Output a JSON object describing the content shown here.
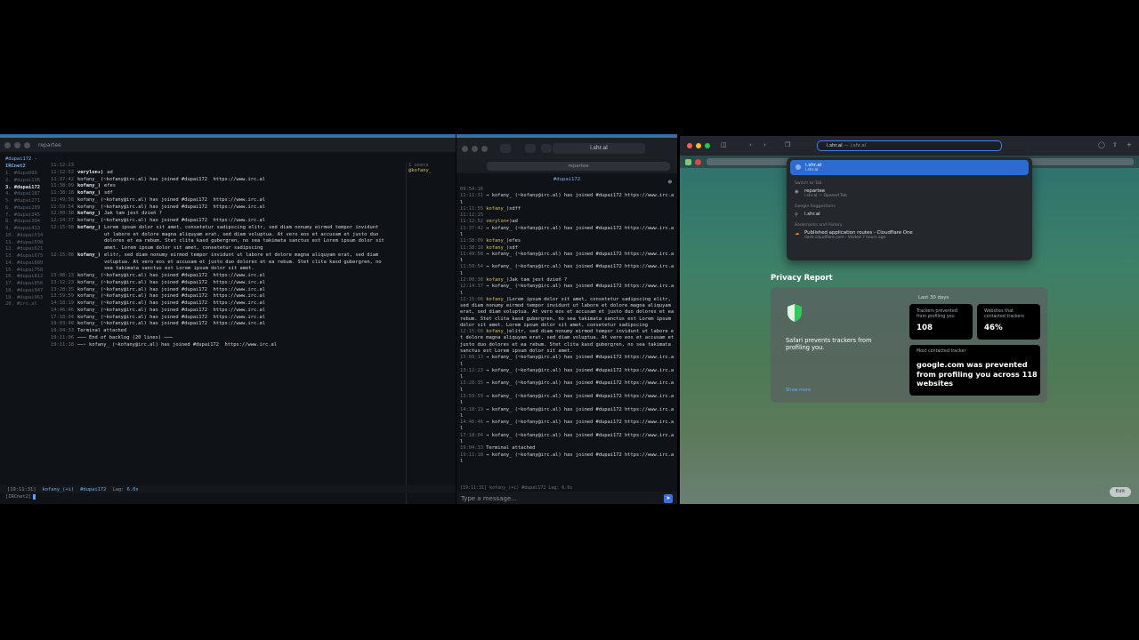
{
  "left_terminal": {
    "window_title": "repartee",
    "channel_header": "#dupai172 -",
    "network_label": "IRCnet2",
    "channels": [
      {
        "label": "1. #dupa999",
        "active": false
      },
      {
        "label": "2. #dupai136",
        "active": false
      },
      {
        "label": "3. #dupai172",
        "active": true
      },
      {
        "label": "4. #dupai187",
        "active": false
      },
      {
        "label": "5. #dupai271",
        "active": false
      },
      {
        "label": "6. #dupai289",
        "active": false
      },
      {
        "label": "7. #dupai345",
        "active": false
      },
      {
        "label": "8. #dupai394",
        "active": false
      },
      {
        "label": "9. #dupai413",
        "active": false
      },
      {
        "label": "10. #dupai534",
        "active": false
      },
      {
        "label": "11. #dupai598",
        "active": false
      },
      {
        "label": "12. #dupai621",
        "active": false
      },
      {
        "label": "13. #dupai675",
        "active": false
      },
      {
        "label": "14. #dupai689",
        "active": false
      },
      {
        "label": "15. #dupai758",
        "active": false
      },
      {
        "label": "16. #dupai812",
        "active": false
      },
      {
        "label": "17. #dupai856",
        "active": false
      },
      {
        "label": "18. #dupai947",
        "active": false
      },
      {
        "label": "19. #dupai963",
        "active": false
      },
      {
        "label": "20. #irc.al",
        "active": false
      }
    ],
    "messages": [
      {
        "ts": "11:12:23",
        "nick": "",
        "text": ""
      },
      {
        "ts": "11:12:52",
        "nick": "verylon+)",
        "text": "ad"
      },
      {
        "ts": "11:37:42",
        "nick": "",
        "text": "kofany_ (~kofany@irc.al) has joined #dupai172  https://www.irc.al"
      },
      {
        "ts": "11:38:09",
        "nick": "kofany_)",
        "text": "efes"
      },
      {
        "ts": "11:38:18",
        "nick": "kofany_)",
        "text": "sdf"
      },
      {
        "ts": "11:49:58",
        "nick": "",
        "text": "kofany_ (~kofany@irc.al) has joined #dupai172  https://www.irc.al"
      },
      {
        "ts": "11:59:54",
        "nick": "",
        "text": "kofany_ (~kofany@irc.al) has joined #dupai172  https://www.irc.al"
      },
      {
        "ts": "12:00:38",
        "nick": "kofany_)",
        "text": "Jak tam jest dzień ?"
      },
      {
        "ts": "12:14:37",
        "nick": "",
        "text": "kofany_ (~kofany@irc.al) has joined #dupai172  https://www.irc.al"
      },
      {
        "ts": "12:15:08",
        "nick": "kofany_)",
        "text": "Lorem ipsum dolor sit amet, consetetur sadipscing elitr, sed diam nonumy eirmod tempor invidunt",
        "cont": [
          "ut labore et dolore magna aliquyam erat, sed diam voluptua. At vero eos et accusam et justo duo",
          "dolores et ea rebum. Stet clita kasd gubergren, no sea takimata sanctus est Lorem ipsum dolor sit",
          "amet. Lorem ipsum dolor sit amet, consetetur sadipscing"
        ]
      },
      {
        "ts": "12:15:08",
        "nick": "kofany_)",
        "text": "elitr, sed diam nonumy eirmod tempor invidunt ut labore et dolore magna aliquyam erat, sed diam",
        "cont": [
          "voluptua. At vero eos et accusam et justo duo dolores et ea rebum. Stet clita kasd gubergren, no",
          "sea takimata sanctus est Lorem ipsum dolor sit amet."
        ]
      },
      {
        "ts": "13:08:13",
        "nick": "",
        "text": "kofany_ (~kofany@irc.al) has joined #dupai172  https://www.irc.al"
      },
      {
        "ts": "13:12:23",
        "nick": "",
        "text": "kofany_ (~kofany@irc.al) has joined #dupai172  https://www.irc.al"
      },
      {
        "ts": "13:28:35",
        "nick": "",
        "text": "kofany_ (~kofany@irc.al) has joined #dupai172  https://www.irc.al"
      },
      {
        "ts": "13:59:59",
        "nick": "",
        "text": "kofany_ (~kofany@irc.al) has joined #dupai172  https://www.irc.al"
      },
      {
        "ts": "14:18:19",
        "nick": "",
        "text": "kofany_ (~kofany@irc.al) has joined #dupai172  https://www.irc.al"
      },
      {
        "ts": "14:46:46",
        "nick": "",
        "text": "kofany_ (~kofany@irc.al) has joined #dupai172  https://www.irc.al"
      },
      {
        "ts": "17:18:04",
        "nick": "",
        "text": "kofany_ (~kofany@irc.al) has joined #dupai172  https://www.irc.al"
      },
      {
        "ts": "19:03:48",
        "nick": "",
        "text": "kofany_ (~kofany@irc.al) has joined #dupai172  https://www.irc.al"
      },
      {
        "ts": "19:04:33",
        "nick": "",
        "text": "Terminal attached"
      },
      {
        "ts": "19:11:06",
        "nick": "",
        "text": "─── End of backlog (20 lines) ───"
      },
      {
        "ts": "19:11:18",
        "nick": "",
        "text": "──› kofany_ (~kofany@irc.al) has joined #dupai172  https://www.irc.al"
      }
    ],
    "users_count": "1 users",
    "users": [
      "@kofany_"
    ],
    "status": {
      "time": "[19:11:31]",
      "nick": "kofany_(+i)",
      "channel": "#dupai172",
      "lag_label": "Lag:",
      "lag_value": "6.0s"
    },
    "input_prompt": "[IRCnet2]"
  },
  "middle_window": {
    "url": "i.shr.al",
    "tab_label": "repartee",
    "channel": "#dupai172",
    "lines": [
      {
        "t": "09:54:16",
        "n": "",
        "x": ""
      },
      {
        "t": "11:11:31",
        "n": "",
        "x": "→ kofany_ (~kofany@irc.al) has joined #dupai172 https://www.irc.al"
      },
      {
        "t": "11:11:55",
        "n": "kofany_",
        "x": ")sdff"
      },
      {
        "t": "11:12:25",
        "n": "",
        "x": ""
      },
      {
        "t": "11:12:52",
        "n": "verylon+",
        "x": ")ad"
      },
      {
        "t": "11:37:42",
        "n": "",
        "x": "→ kofany_ (~kofany@irc.al) has joined #dupai172 https://www.irc.al"
      },
      {
        "t": "11:38:09",
        "n": "kofany_",
        "x": ")efes"
      },
      {
        "t": "11:38:18",
        "n": "kofany_",
        "x": ")sdf"
      },
      {
        "t": "11:49:58",
        "n": "",
        "x": "→ kofany_ (~kofany@irc.al) has joined #dupai172 https://www.irc.al"
      },
      {
        "t": "11:59:54",
        "n": "",
        "x": "→ kofany_ (~kofany@irc.al) has joined #dupai172 https://www.irc.al"
      },
      {
        "t": "12:00:38",
        "n": "kofany_",
        "x": ")Jak tam jest dzień ?"
      },
      {
        "t": "12:14:37",
        "n": "",
        "x": "→ kofany_ (~kofany@irc.al) has joined #dupai172 https://www.irc.al"
      },
      {
        "t": "12:15:08",
        "n": "kofany_",
        "x": ")Lorem ipsum dolor sit amet, consetetur sadipscing elitr, sed diam nonumy eirmod tempor invidunt ut labore et dolore magna aliquyam erat, sed diam voluptua. At vero eos et accusam et justo duo dolores et ea rebum. Stet clita kasd gubergren, no sea takimata sanctus est Lorem ipsum dolor sit amet. Lorem ipsum dolor sit amet, consetetur sadipscing"
      },
      {
        "t": "12:15:08",
        "n": "kofany_",
        "x": ")elitr, sed diam nonumy eirmod tempor invidunt ut labore et dolore magna aliquyam erat, sed diam voluptua. At vero eos et accusam et justo duo dolores et ea rebum. Stet clita kasd gubergren, no sea takimata sanctus est Lorem ipsum dolor sit amet."
      },
      {
        "t": "13:08:13",
        "n": "",
        "x": "→ kofany_ (~kofany@irc.al) has joined #dupai172 https://www.irc.al"
      },
      {
        "t": "13:12:23",
        "n": "",
        "x": "→ kofany_ (~kofany@irc.al) has joined #dupai172 https://www.irc.al"
      },
      {
        "t": "13:28:35",
        "n": "",
        "x": "→ kofany_ (~kofany@irc.al) has joined #dupai172 https://www.irc.al"
      },
      {
        "t": "13:59:59",
        "n": "",
        "x": "→ kofany_ (~kofany@irc.al) has joined #dupai172 https://www.irc.al"
      },
      {
        "t": "14:18:19",
        "n": "",
        "x": "→ kofany_ (~kofany@irc.al) has joined #dupai172 https://www.irc.al"
      },
      {
        "t": "14:46:46",
        "n": "",
        "x": "→ kofany_ (~kofany@irc.al) has joined #dupai172 https://www.irc.al"
      },
      {
        "t": "17:18:04",
        "n": "",
        "x": "→ kofany_ (~kofany@irc.al) has joined #dupai172 https://www.irc.al"
      },
      {
        "t": "19:04:33",
        "n": "",
        "x": "Terminal attached"
      },
      {
        "t": "19:11:18",
        "n": "",
        "x": "→ kofany_ (~kofany@irc.al) has joined #dupai172 https://www.irc.al"
      }
    ],
    "status_line": "[19:11:31] kofany_(+i) #dupai172 Lag: 6.0s",
    "composer_placeholder": "Type a message...",
    "send_icon": "send-icon"
  },
  "safari": {
    "address_text": "i.shr.al",
    "address_suffix": " — i.shr.al",
    "suggestions": {
      "top_hit": {
        "title": "i.shr.al",
        "subtitle": "i.shr.al"
      },
      "switch_to_tab_header": "Switch to Tab",
      "switch_item": {
        "title": "repartee",
        "subtitle": "i.shr.al — Opened Tab"
      },
      "google_header": "Google Suggestions",
      "google_item": "i.shr.al",
      "bookmarks_header": "Bookmarks and History",
      "bookmark_item": {
        "title": "Published application routes - Cloudflare One",
        "subtitle": "dash.cloudflare.com - Visited 7 hours ago"
      }
    },
    "privacy": {
      "title": "Privacy Report",
      "prevents_text": "Safari prevents trackers from profiling you.",
      "show_more": "Show more",
      "period": "Last 30 days",
      "trackers_label": "Trackers prevented from profiling you",
      "trackers_value": "108",
      "websites_label": "Websites that contacted trackers",
      "websites_value": "46%",
      "most_contacted_label": "Most contacted tracker",
      "most_contacted_text": "google.com was prevented from profiling you across 118 websites"
    },
    "edit_label": "Edit"
  },
  "colors": {
    "accent_blue": "#3b82f6",
    "shield_green": "#34c759",
    "terminal_bg": "#0f1216"
  }
}
